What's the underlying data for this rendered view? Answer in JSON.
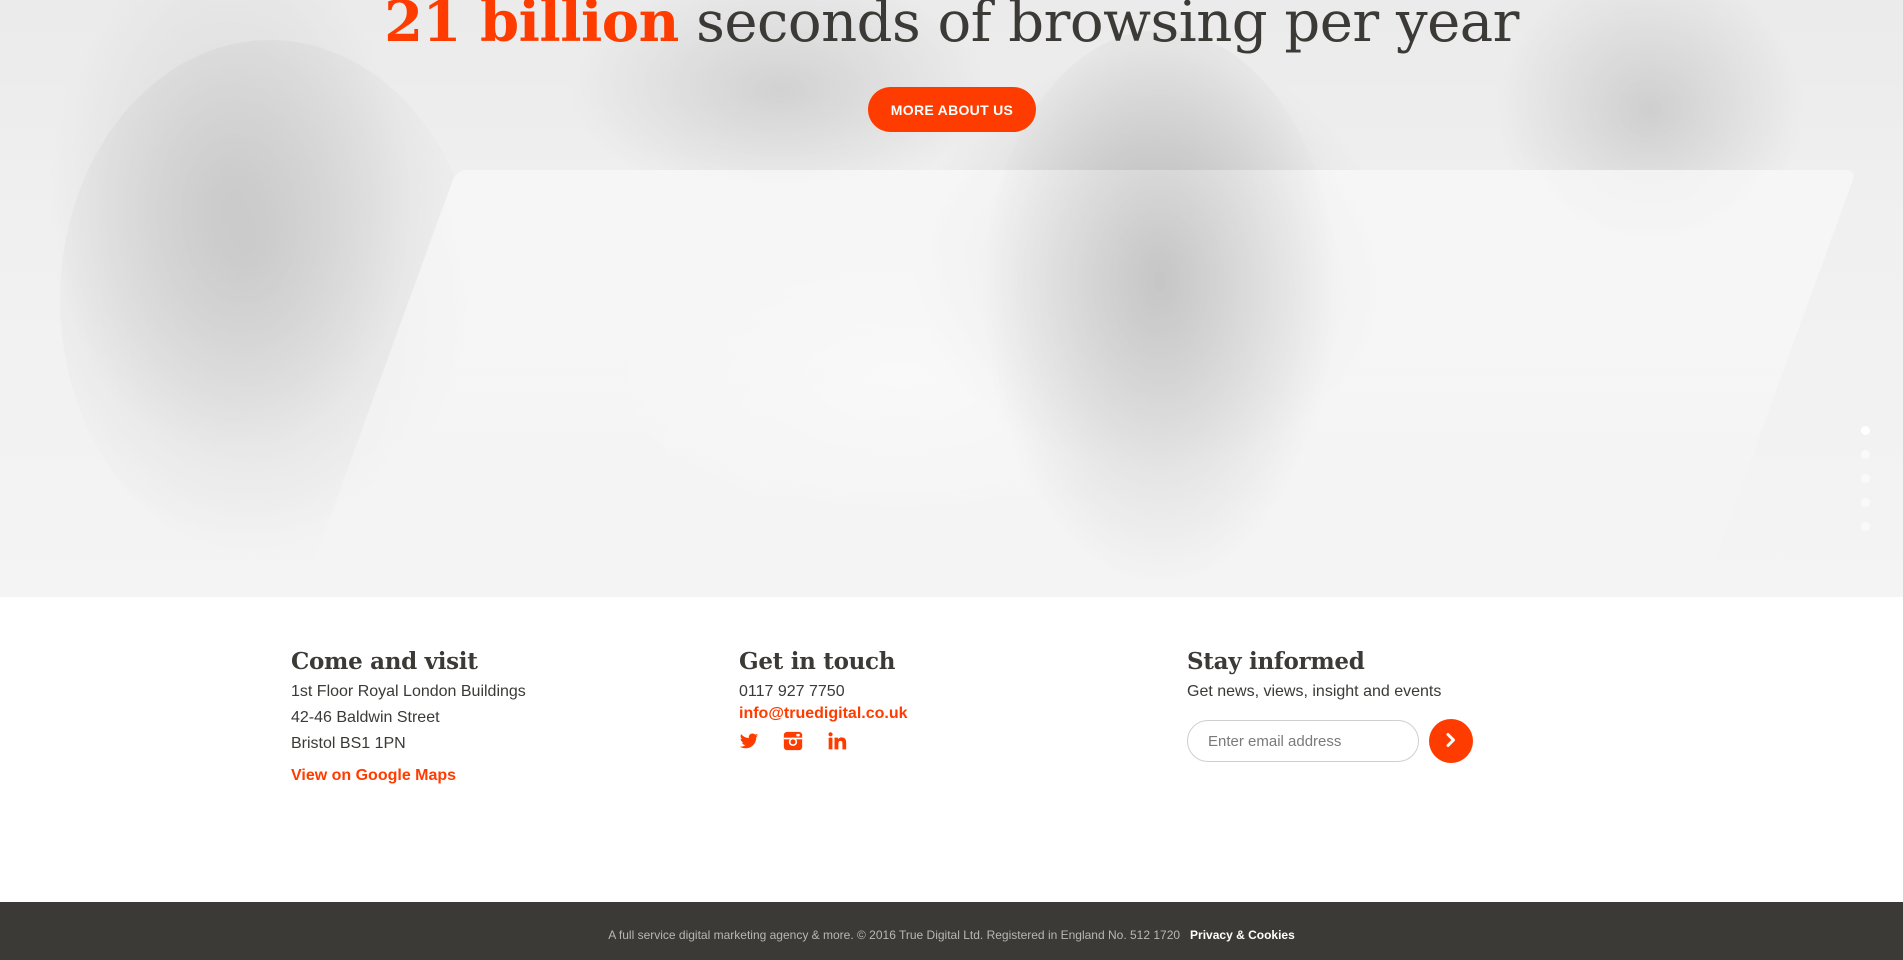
{
  "hero": {
    "headline_accent": "21 billion",
    "headline_rest": " seconds of browsing per year",
    "cta_label": "MORE ABOUT US",
    "slide_dots": 5
  },
  "visit": {
    "title": "Come and visit",
    "address_line1": "1st Floor Royal London Buildings",
    "address_line2": "42-46 Baldwin Street",
    "address_line3": "Bristol BS1 1PN",
    "maps_link": "View on Google Maps"
  },
  "contact": {
    "title": "Get in touch",
    "phone": "0117 927 7750",
    "email": "info@truedigital.co.uk",
    "socials": [
      "twitter-icon",
      "instagram-icon",
      "linkedin-icon"
    ]
  },
  "newsletter": {
    "title": "Stay informed",
    "description": "Get news, views, insight and events",
    "email_placeholder": "Enter email address",
    "submit_icon": "chevron-right-icon"
  },
  "footer": {
    "legal": "A full service digital marketing agency & more. © 2016 True Digital Ltd. Registered in England No. 512 1720",
    "privacy_link": "Privacy & Cookies"
  },
  "colors": {
    "accent": "#ff3c00",
    "dark": "#3b3a36",
    "footer_text": "#b9b7b0"
  }
}
